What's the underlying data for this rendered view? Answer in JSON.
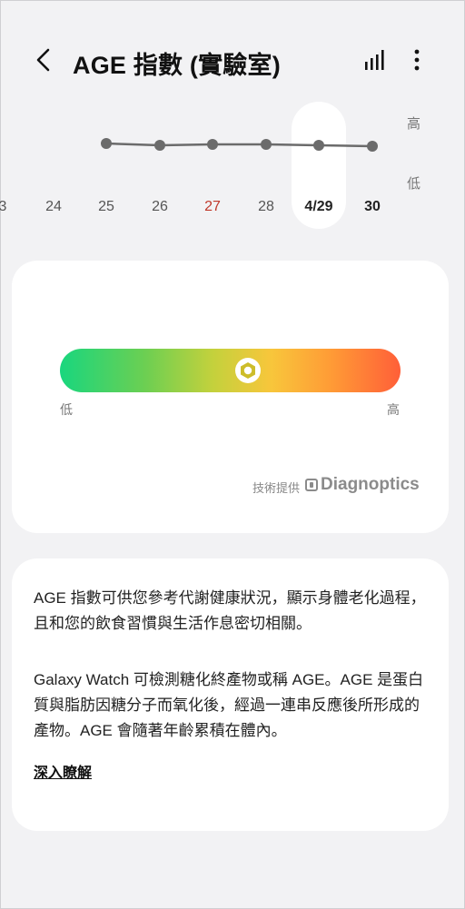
{
  "header": {
    "title": "AGE 指數 (實驗室)"
  },
  "trend": {
    "axis_high": "高",
    "axis_low": "低",
    "dates": [
      {
        "label": "3"
      },
      {
        "label": "24"
      },
      {
        "label": "25"
      },
      {
        "label": "26"
      },
      {
        "label": "27"
      },
      {
        "label": "28"
      },
      {
        "label": "4/29"
      },
      {
        "label": "30"
      }
    ],
    "selected_label": "4/29",
    "highlight_color": "#c0392b"
  },
  "gauge": {
    "low_label": "低",
    "high_label": "高",
    "provider_label": "技術提供",
    "provider_name": "Diagnoptics"
  },
  "info": {
    "paragraph1": "AGE 指數可供您參考代謝健康狀況，顯示身體老化過程，且和您的飲食習慣與生活作息密切相關。",
    "paragraph2": "Galaxy Watch 可檢測糖化終產物或稱 AGE。AGE 是蛋白質與脂肪因糖分子而氧化後，經過一連串反應後所形成的產物。AGE 會隨著年齡累積在體內。",
    "learn_more": "深入瞭解"
  }
}
